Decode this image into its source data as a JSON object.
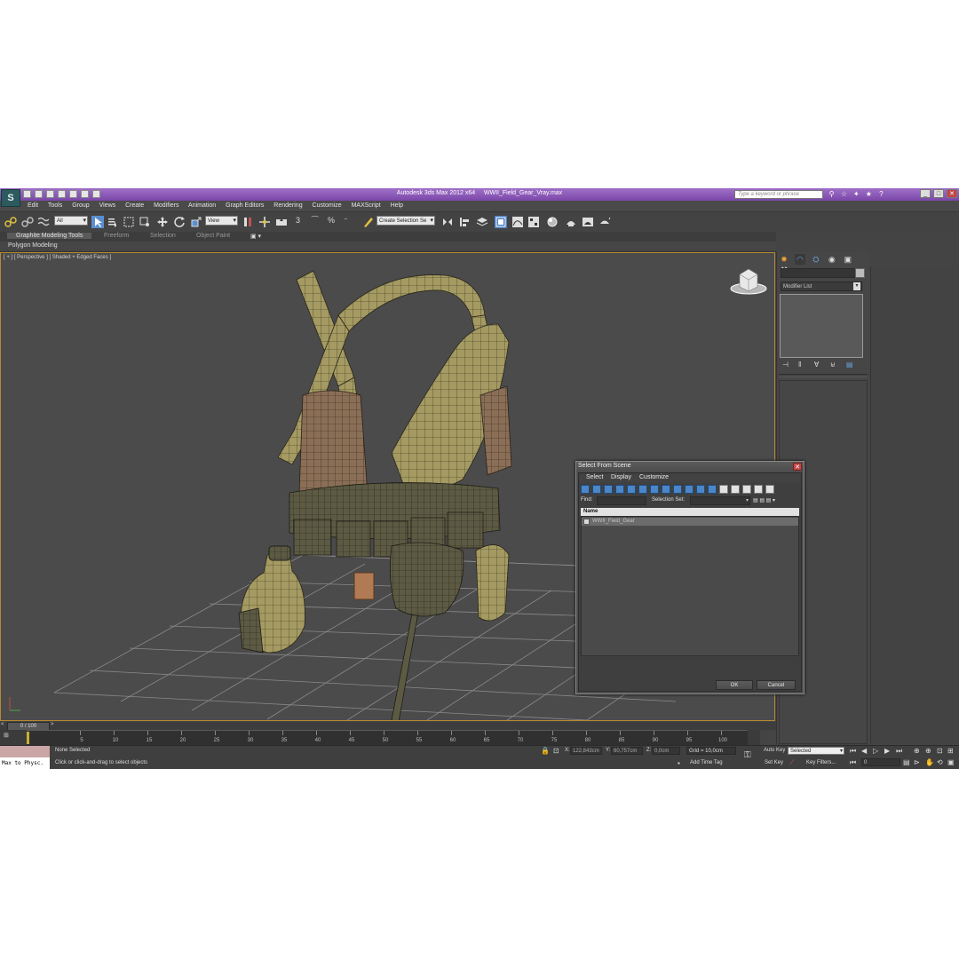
{
  "window": {
    "app_title": "Autodesk 3ds Max  2012 x64",
    "file_name": "WWII_Field_Gear_Vray.max",
    "search_placeholder": "Type a keyword or phrase",
    "logo_label": "S",
    "min": "_",
    "restore": "□",
    "close": "✕"
  },
  "menu": [
    "Edit",
    "Tools",
    "Group",
    "Views",
    "Create",
    "Modifiers",
    "Animation",
    "Graph Editors",
    "Rendering",
    "Customize",
    "MAXScript",
    "Help"
  ],
  "toolbar": {
    "filter_value": "All",
    "refcoord_value": "View",
    "snaps": [
      "3",
      "⁀",
      "%",
      "⁻"
    ],
    "named_selection_placeholder": "Create Selection Se"
  },
  "ribbon": {
    "tabs": [
      "Graphite Modeling Tools",
      "Freeform",
      "Selection",
      "Object Paint"
    ],
    "subpanel": "Polygon Modeling"
  },
  "viewport": {
    "label": "[ + ] [ Perspective ] [ Shaded + Edged Faces ]"
  },
  "command_panel": {
    "modifier_list": "Modifier List"
  },
  "dialog": {
    "title": "Select From Scene",
    "close": "✕",
    "menu": [
      "Select",
      "Display",
      "Customize"
    ],
    "find_label": "Find:",
    "selection_set_label": "Selection Set:",
    "column_name": "Name",
    "items": [
      "WWII_Field_Gear"
    ],
    "ok_label": "OK",
    "cancel_label": "Cancel"
  },
  "timeline": {
    "frame_display": "0 / 100",
    "ticks": [
      "5",
      "10",
      "15",
      "20",
      "25",
      "30",
      "35",
      "40",
      "45",
      "50",
      "55",
      "60",
      "65",
      "70",
      "75",
      "80",
      "85",
      "90",
      "95",
      "100"
    ]
  },
  "status": {
    "maxscript_listener": "Max to Physc.",
    "selection_info": "None Selected",
    "prompt": "Click or click-and-drag to select objects",
    "x_label": "X:",
    "x_value": "122,843cm",
    "y_label": "Y:",
    "y_value": "60,757cm",
    "z_label": "Z:",
    "z_value": "0,0cm",
    "grid": "Grid = 10,0cm",
    "add_time_tag": "Add Time Tag",
    "auto_key": "Auto Key",
    "set_key": "Set Key",
    "selected_value": "Selected",
    "key_filters": "Key Filters...",
    "current_frame": "0"
  },
  "colors": {
    "title_bar": "#7a46a8",
    "viewport_bg": "#4b4b4b",
    "viewport_border": "#b38a2e",
    "grid_line": "#8a8a8a",
    "mesh_khaki": "#a49a62",
    "mesh_pouch": "#8a6e56",
    "mesh_dark": "#5d5a44",
    "dialog_bg": "#4f4f4f",
    "dialog_close": "#c24646"
  }
}
